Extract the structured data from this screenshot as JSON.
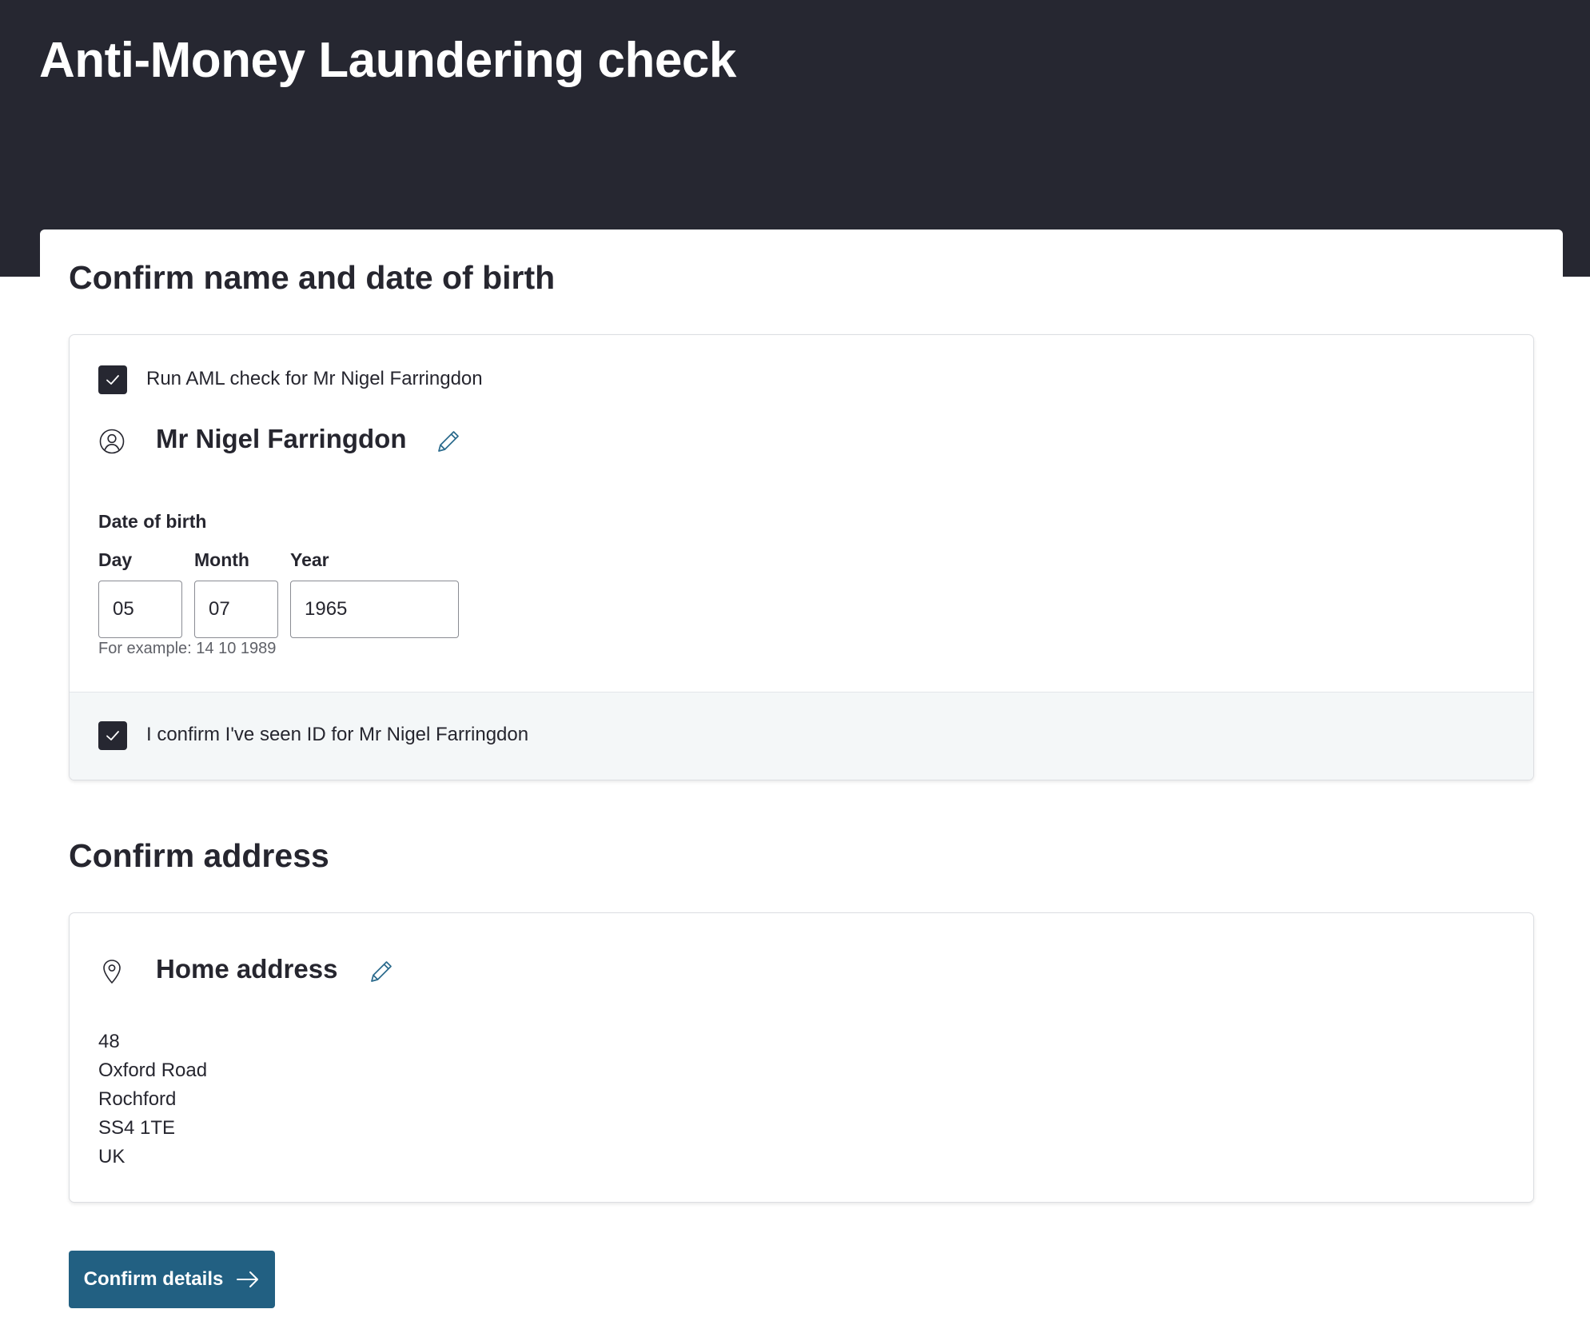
{
  "header": {
    "title": "Anti-Money Laundering check"
  },
  "identity_section": {
    "heading": "Confirm name and date of birth",
    "run_check": {
      "checked": true,
      "label": "Run AML check for Mr Nigel Farringdon"
    },
    "person": {
      "icon": "user-circle-icon",
      "name": "Mr Nigel Farringdon",
      "edit_icon": "pencil-icon"
    },
    "dob": {
      "label": "Date of birth",
      "day_label": "Day",
      "month_label": "Month",
      "year_label": "Year",
      "day_value": "05",
      "month_value": "07",
      "year_value": "1965",
      "hint": "For example: 14 10 1989"
    },
    "id_confirm": {
      "checked": true,
      "label": "I confirm I've seen ID for Mr Nigel Farringdon"
    }
  },
  "address_section": {
    "heading": "Confirm address",
    "address": {
      "icon": "map-pin-icon",
      "title": "Home address",
      "edit_icon": "pencil-icon",
      "lines": [
        "48",
        "Oxford Road",
        "Rochford",
        "SS4 1TE",
        "UK"
      ]
    }
  },
  "actions": {
    "confirm_label": "Confirm details",
    "confirm_icon": "arrow-right-icon"
  },
  "colors": {
    "header_bg": "#262731",
    "primary_button": "#226082",
    "checkbox_fill": "#262731",
    "edit_icon": "#2a6a8c",
    "confirm_strip_bg": "#f4f7f8"
  }
}
